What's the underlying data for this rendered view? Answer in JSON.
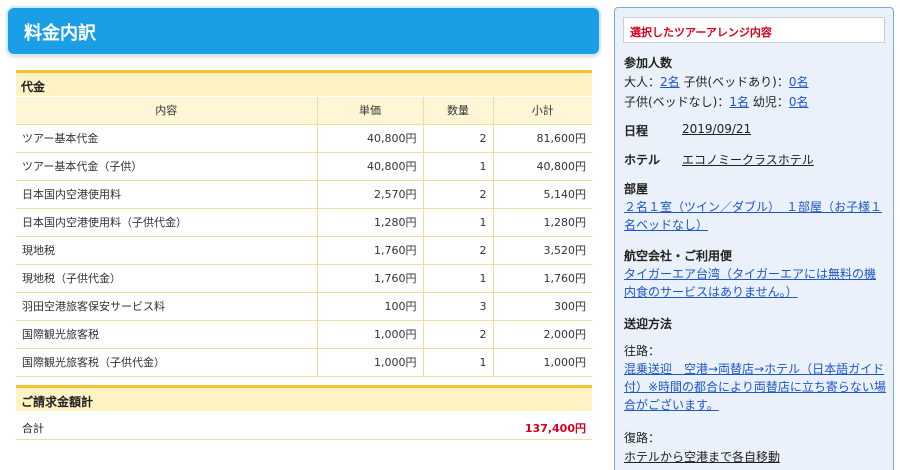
{
  "page_title": "料金内訳",
  "charges": {
    "section_title": "代金",
    "columns": [
      "内容",
      "単価",
      "数量",
      "小計"
    ],
    "rows": [
      {
        "item": "ツアー基本代金",
        "unit_price": "40,800円",
        "qty": "2",
        "subtotal": "81,600円"
      },
      {
        "item": "ツアー基本代金（子供）",
        "unit_price": "40,800円",
        "qty": "1",
        "subtotal": "40,800円"
      },
      {
        "item": "日本国内空港使用料",
        "unit_price": "2,570円",
        "qty": "2",
        "subtotal": "5,140円"
      },
      {
        "item": "日本国内空港使用料（子供代金）",
        "unit_price": "1,280円",
        "qty": "1",
        "subtotal": "1,280円"
      },
      {
        "item": "現地税",
        "unit_price": "1,760円",
        "qty": "2",
        "subtotal": "3,520円"
      },
      {
        "item": "現地税（子供代金）",
        "unit_price": "1,760円",
        "qty": "1",
        "subtotal": "1,760円"
      },
      {
        "item": "羽田空港旅客保安サービス料",
        "unit_price": "100円",
        "qty": "3",
        "subtotal": "300円"
      },
      {
        "item": "国際観光旅客税",
        "unit_price": "1,000円",
        "qty": "2",
        "subtotal": "2,000円"
      },
      {
        "item": "国際観光旅客税（子供代金）",
        "unit_price": "1,000円",
        "qty": "1",
        "subtotal": "1,000円"
      }
    ]
  },
  "billing": {
    "section_title": "ご請求金額計",
    "total_label": "合計",
    "total_value": "137,400円"
  },
  "sidebar": {
    "header": "選択したツアーアレンジ内容",
    "participants": {
      "heading": "参加人数",
      "adult_label": "大人：",
      "adult_value": "2名",
      "child_bed_label": " 子供(ベッドあり)：",
      "child_bed_value": "0名",
      "child_nobed_label": "子供(ベッドなし)：",
      "child_nobed_value": "1名",
      "infant_label": " 幼児：",
      "infant_value": "0名"
    },
    "schedule": {
      "label": "日程",
      "value": "2019/09/21"
    },
    "hotel": {
      "label": "ホテル",
      "value": "エコノミークラスホテル"
    },
    "room": {
      "heading": "部屋",
      "value": "２名１室（ツイン／ダブル）　１部屋（お子様１名ベッドなし）"
    },
    "airline": {
      "heading": "航空会社・ご利用便",
      "value": "タイガーエア台湾（タイガーエアには無料の機内食のサービスはありません。）"
    },
    "transfer": {
      "heading": "送迎方法",
      "outbound_label": "往路：",
      "outbound_value": "混乗送迎　空港→両替店→ホテル（日本語ガイド付）※時間の都合により両替店に立ち寄らない場合がございます。",
      "return_label": "復路：",
      "return_value": "ホテルから空港まで各自移動"
    }
  }
}
